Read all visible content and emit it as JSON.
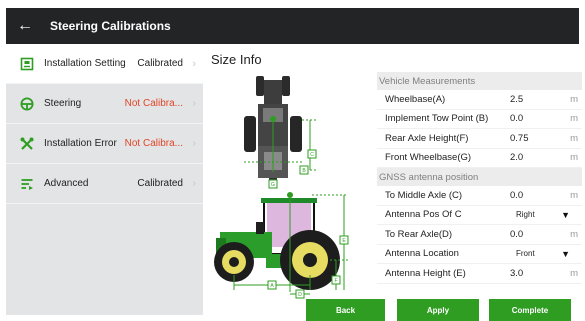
{
  "header": {
    "title": "Steering Calibrations",
    "back_icon": "back-arrow-icon"
  },
  "sidebar": {
    "items": [
      {
        "label": "Installation Setting",
        "status": "Calibrated",
        "state": "ok",
        "icon": "installation-icon"
      },
      {
        "label": "Steering",
        "status": "Not Calibra...",
        "state": "bad",
        "icon": "steering-wheel-icon"
      },
      {
        "label": "Installation Error",
        "status": "Not Calibra...",
        "state": "bad",
        "icon": "tools-icon"
      },
      {
        "label": "Advanced",
        "status": "Calibrated",
        "state": "ok",
        "icon": "advanced-icon"
      }
    ]
  },
  "main": {
    "title": "Size Info",
    "illustration_labels": [
      "A",
      "B",
      "C",
      "D",
      "E",
      "F",
      "G"
    ],
    "vehicle_section": "Vehicle Measurements",
    "vehicle_rows": [
      {
        "label": "Wheelbase(A)",
        "value": "2.5",
        "unit": "m"
      },
      {
        "label": "Implement Tow Point (B)",
        "value": "0.0",
        "unit": "m"
      },
      {
        "label": "Rear Axle Height(F)",
        "value": "0.75",
        "unit": "m"
      },
      {
        "label": "Front Wheelbase(G)",
        "value": "2.0",
        "unit": "m"
      }
    ],
    "gnss_section": "GNSS antenna position",
    "gnss_rows": [
      {
        "label": "To Middle Axle (C)",
        "value": "0.0",
        "unit": "m"
      },
      {
        "label": "Antenna Pos Of C",
        "selected": "Right"
      },
      {
        "label": "To Rear Axle(D)",
        "value": "0.0",
        "unit": "m"
      },
      {
        "label": "Antenna Location",
        "selected": "Front"
      },
      {
        "label": "Antenna Height (E)",
        "value": "3.0",
        "unit": "m"
      }
    ]
  },
  "buttons": {
    "back": "Back",
    "apply": "Apply",
    "complete": "Complete"
  },
  "colors": {
    "accent": "#2e9d22",
    "titlebar": "#222426",
    "warning": "#e2462a",
    "sidebar": "#e3e4e5"
  }
}
